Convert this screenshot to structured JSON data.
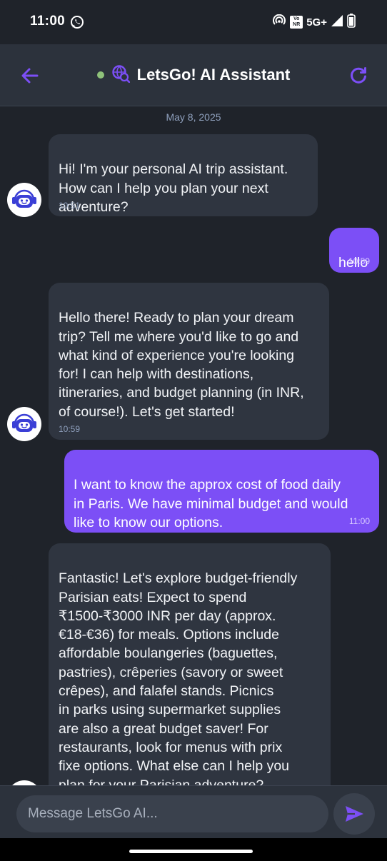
{
  "status_bar": {
    "time": "11:00",
    "left_icon": "whatsapp-icon",
    "right_icons": [
      "hotspot-icon",
      "vonr-icon",
      "signal-icon",
      "battery-icon"
    ],
    "vonr_line1": "Vo",
    "vonr_line2": "NR",
    "network": "5G+"
  },
  "header": {
    "title": "LetsGo! AI Assistant",
    "back_icon": "back-arrow-icon",
    "status_dot_color": "#8fc27a",
    "assistant_icon": "globe-search-icon",
    "refresh_icon": "refresh-icon"
  },
  "chat": {
    "date": "May 8, 2025",
    "messages": [
      {
        "sender": "bot",
        "text": "Hi! I'm your personal AI trip assistant.\nHow can I help you plan your next\nadventure?",
        "time": "10:51"
      },
      {
        "sender": "user",
        "text": "hello",
        "time": "10:59"
      },
      {
        "sender": "bot",
        "text": "Hello there!  Ready to plan your dream\ntrip?  Tell me where you'd like to go and\nwhat kind of experience you're looking\nfor!  I can help with destinations,\nitineraries, and budget planning (in INR,\nof course!). Let's get started!",
        "time": "10:59"
      },
      {
        "sender": "user",
        "text": "I want to know the approx cost of food daily\nin Paris. We have minimal budget and would\nlike to know our options.",
        "time": "11:00"
      },
      {
        "sender": "bot",
        "text": "Fantastic!  Let's explore budget-friendly\nParisian eats!  Expect to spend\n₹1500-₹3000 INR per day (approx.\n€18-€36) for meals.  Options include\naffordable boulangeries (baguettes,\npastries), crêperies (savory or sweet\ncrêpes), and falafel stands.  Picnics\nin parks using supermarket supplies\nare also a great budget saver!  For\nrestaurants, look for menus with prix\nfixe options.  What else can I help you\nplan for your Parisian adventure?",
        "time": ""
      }
    ]
  },
  "input": {
    "placeholder": "Message LetsGo AI...",
    "value": "",
    "send_icon": "send-icon"
  },
  "colors": {
    "accent": "#7c4ff6",
    "background": "#1f232a",
    "surface": "#2c323c",
    "bot_bubble": "#2f3540",
    "muted_text": "#8fa0bd"
  }
}
